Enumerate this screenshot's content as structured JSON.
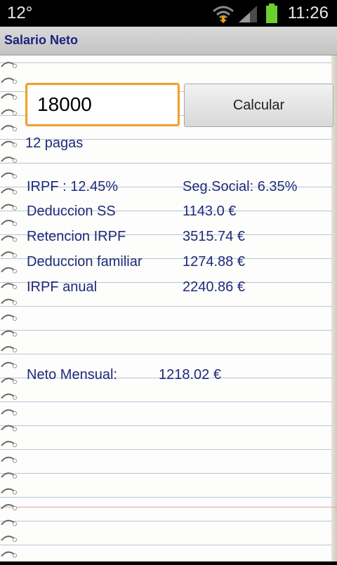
{
  "status_bar": {
    "temperature": "12°",
    "time": "11:26"
  },
  "app": {
    "title": "Salario Neto"
  },
  "form": {
    "salary_value": "18000",
    "calculate_label": "Calcular",
    "payments_label": "12 pagas"
  },
  "results": {
    "irpf_rate": "IRPF : 12.45%",
    "ss_rate": "Seg.Social: 6.35%",
    "rows": [
      {
        "label": "Deduccion SS",
        "value": "1143.0 €"
      },
      {
        "label": "Retencion IRPF",
        "value": "3515.74 €"
      },
      {
        "label": "Deduccion familiar",
        "value": "1274.88 €"
      },
      {
        "label": "IRPF anual",
        "value": "2240.86 €"
      }
    ],
    "net_label": "Neto Mensual:",
    "net_value": "1218.02 €"
  },
  "colors": {
    "text": "#1f2a7a",
    "input_focus": "#f0a030",
    "title": "#1a237e"
  },
  "icons": [
    "wifi-icon",
    "signal-icon",
    "battery-icon",
    "spiral-binding"
  ]
}
